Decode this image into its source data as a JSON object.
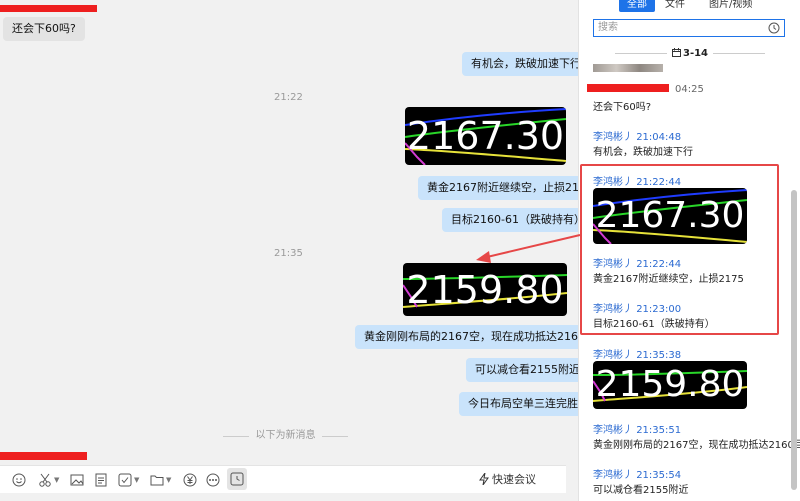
{
  "chat": {
    "messages": {
      "m1": "还会下60吗?",
      "m2": "有机会，跌破加速下行",
      "t1": "21:22",
      "img1": "2167.30",
      "m3": "黄金2167附近继续空，止损2175",
      "m4": "目标2160-61（跌破持有）",
      "t2": "21:35",
      "img2": "2159.80",
      "m5": "黄金刚刚布局的2167空，现在成功抵达2160目标",
      "m6": "可以减仓看2155附近",
      "m7": "今日布局空单三连完胜"
    },
    "divider": "以下为新消息"
  },
  "toolbar": {
    "meeting_label": "快速会议",
    "icons": [
      "emoji-icon",
      "scissors-icon",
      "image-icon",
      "document-icon",
      "checkbox-icon",
      "folder-icon",
      "currency-icon",
      "more-icon",
      "history-icon",
      "flash-icon"
    ]
  },
  "sidebar": {
    "tabs": [
      "全部",
      "文件",
      "图片/视频"
    ],
    "search_placeholder": "搜索",
    "date": "3-14",
    "items": [
      {
        "time": "04:25",
        "text": "还会下60吗?"
      },
      {
        "name": "李鸿彬丿",
        "time": "21:04:48",
        "text": "有机会，跌破加速下行"
      },
      {
        "name": "李鸿彬丿",
        "time": "21:22:44",
        "image": "2167.30"
      },
      {
        "name": "李鸿彬丿",
        "time": "21:22:44",
        "text": "黄金2167附近继续空，止损2175"
      },
      {
        "name": "李鸿彬丿",
        "time": "21:23:00",
        "text": "目标2160-61（跌破持有）"
      },
      {
        "name": "李鸿彬丿",
        "time": "21:35:38",
        "image": "2159.80"
      },
      {
        "name": "李鸿彬丿",
        "time": "21:35:51",
        "text": "黄金刚刚布局的2167空，现在成功抵达2160目标"
      },
      {
        "name": "李鸿彬丿",
        "time": "21:35:54",
        "text": "可以减仓看2155附近"
      }
    ]
  },
  "colors": {
    "accent": "#1e73e8",
    "bubble": "#c9e3fb",
    "highlight": "#e64747",
    "redaction": "#ee1f1f"
  }
}
